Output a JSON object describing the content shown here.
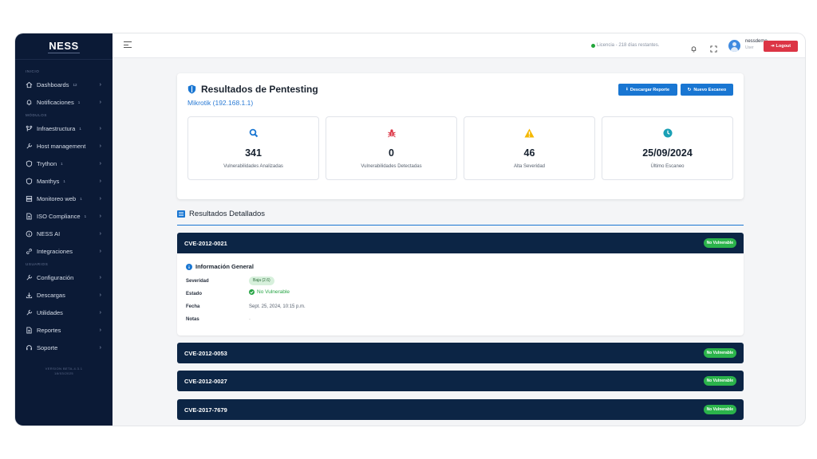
{
  "app": {
    "name": "NESS"
  },
  "sidebar": {
    "sections": [
      {
        "title": "INICIO"
      },
      {
        "title": "MÓDULOS"
      },
      {
        "title": "USUARIOS"
      }
    ],
    "items": [
      {
        "label": "Dashboards",
        "badge": "12",
        "icon": "home-icon"
      },
      {
        "label": "Notificaciones",
        "badge": "1",
        "icon": "bell-icon"
      },
      {
        "label": "Infraestructura",
        "badge": "1",
        "icon": "network-icon"
      },
      {
        "label": "Host management",
        "badge": "",
        "icon": "tools-icon"
      },
      {
        "label": "Trython",
        "badge": "1",
        "icon": "shield-icon"
      },
      {
        "label": "Manthys",
        "badge": "1",
        "icon": "shield-icon"
      },
      {
        "label": "Monitoreo web",
        "badge": "1",
        "icon": "server-icon"
      },
      {
        "label": "ISO Compliance",
        "badge": "1",
        "icon": "document-icon"
      },
      {
        "label": "NESS AI",
        "badge": "",
        "icon": "info-icon"
      },
      {
        "label": "Integraciones",
        "badge": "",
        "icon": "link-icon"
      },
      {
        "label": "Configuración",
        "badge": "",
        "icon": "tools-icon"
      },
      {
        "label": "Descargas",
        "badge": "",
        "icon": "download-icon"
      },
      {
        "label": "Utilidades",
        "badge": "",
        "icon": "tools-icon"
      },
      {
        "label": "Reportes",
        "badge": "",
        "icon": "document-icon"
      },
      {
        "label": "Soporte",
        "badge": "",
        "icon": "headset-icon"
      }
    ],
    "version_line1": "VERSION BETA-4.3.1",
    "version_line2": "18/03/2025"
  },
  "topbar": {
    "license_text": "Licencia - 218 días restantes.",
    "user_name": "nessdemo",
    "user_role": "User",
    "logout_label": "Logout"
  },
  "main": {
    "title": "Resultados de Pentesting",
    "subtitle": "Mikrotik (192.168.1.1)",
    "download_label": "Descargar Reporte",
    "new_scan_label": "Nuevo Escaneo",
    "stats": [
      {
        "value": "341",
        "label": "Vulnerabilidades Analizadas",
        "icon": "search-icon",
        "color": "#1976d2"
      },
      {
        "value": "0",
        "label": "Vulnerabilidades Detectadas",
        "icon": "bug-icon",
        "color": "#dc3545"
      },
      {
        "value": "46",
        "label": "Alta Severidad",
        "icon": "warning-icon",
        "color": "#f5b800"
      },
      {
        "value": "25/09/2024",
        "label": "Último Escaneo",
        "icon": "clock-icon",
        "color": "#1aa0b5"
      }
    ],
    "details_title": "Resultados Detallados",
    "cves": [
      {
        "id": "CVE-2012-0021",
        "status": "No Vulnerable"
      },
      {
        "id": "CVE-2012-0053",
        "status": "No Vulnerable"
      },
      {
        "id": "CVE-2012-0027",
        "status": "No Vulnerable"
      },
      {
        "id": "CVE-2017-7679",
        "status": "No Vulnerable"
      }
    ],
    "info": {
      "title": "Información General",
      "severity_label": "Severidad",
      "severity_value": "Baja (2.6)",
      "state_label": "Estado",
      "state_value": "No Vulnerable",
      "date_label": "Fecha",
      "date_value": "Sept. 25, 2024, 10:15 p.m.",
      "notes_label": "Notas",
      "notes_value": "-"
    }
  }
}
